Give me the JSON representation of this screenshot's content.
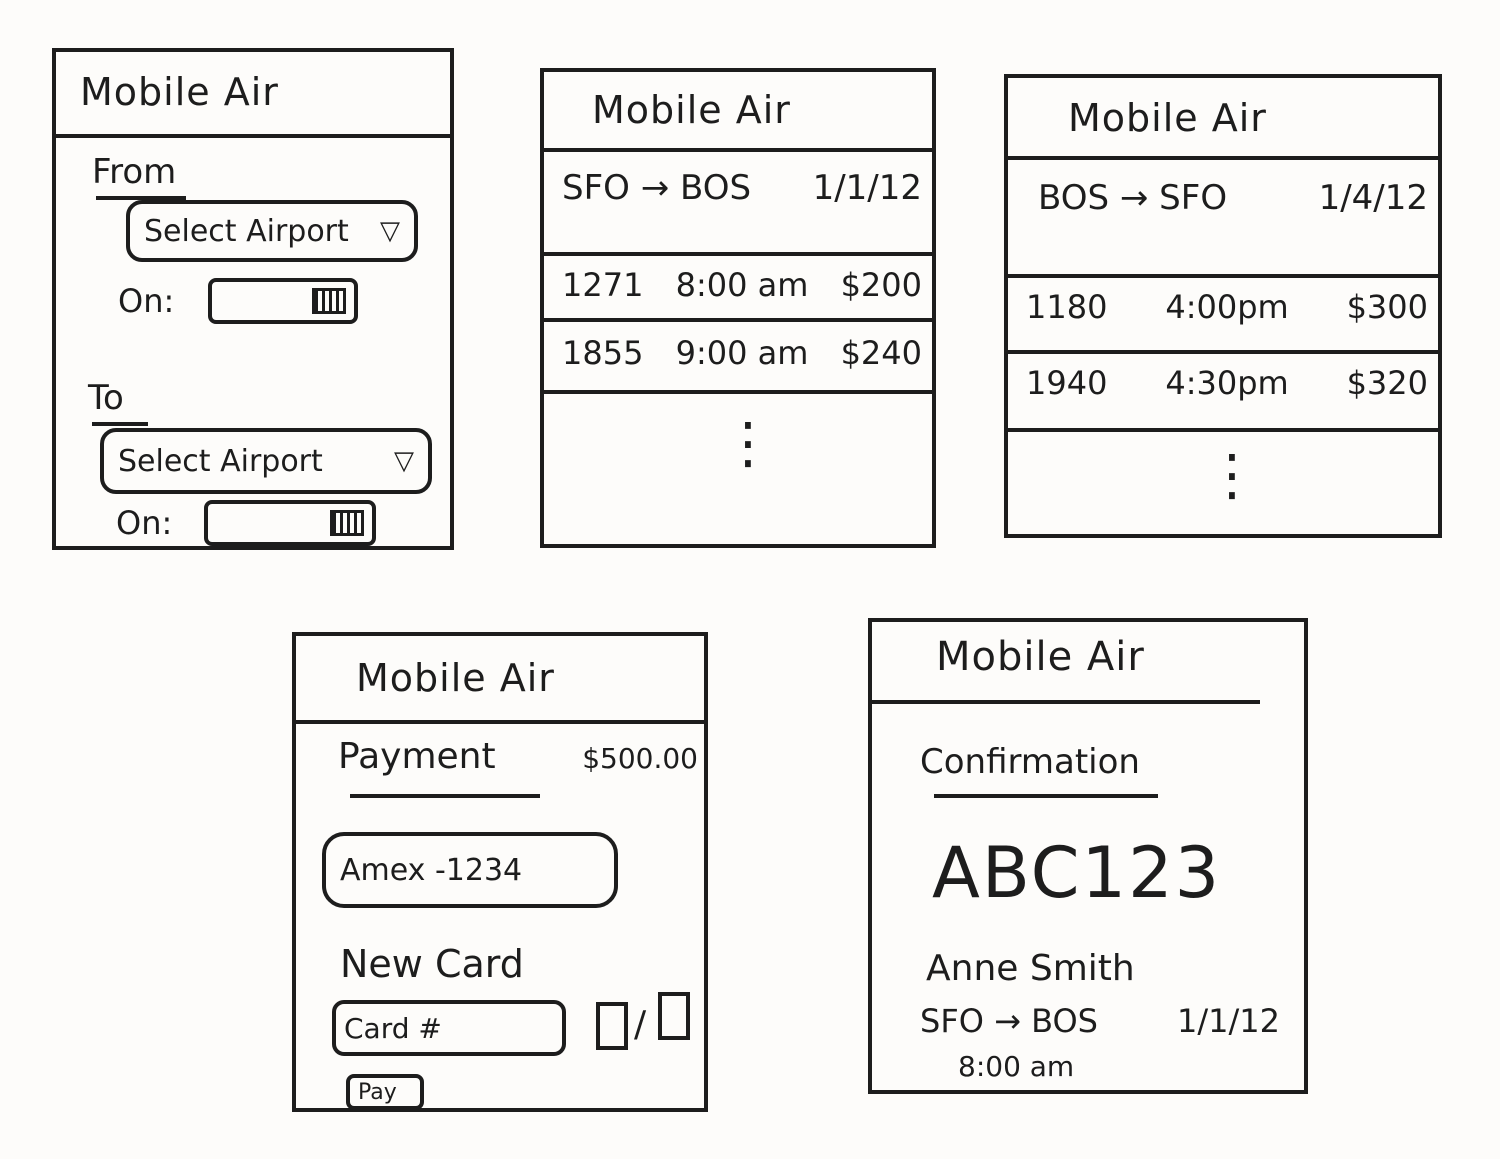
{
  "app_title": "Mobile Air",
  "search": {
    "from_label": "From",
    "from_select": "Select Airport",
    "from_on_label": "On:",
    "to_label": "To",
    "to_select": "Select Airport",
    "to_on_label": "On:",
    "caret": "▽"
  },
  "outbound": {
    "route": "SFO → BOS",
    "date": "1/1/12",
    "flights": [
      {
        "number": "1271",
        "time": "8:00 am",
        "price": "$200"
      },
      {
        "number": "1855",
        "time": "9:00 am",
        "price": "$240"
      }
    ],
    "more": "⋮"
  },
  "return": {
    "route": "BOS → SFO",
    "date": "1/4/12",
    "flights": [
      {
        "number": "1180",
        "time": "4:00pm",
        "price": "$300"
      },
      {
        "number": "1940",
        "time": "4:30pm",
        "price": "$320"
      }
    ],
    "more": "⋮"
  },
  "payment": {
    "title": "Payment",
    "total": "$500.00",
    "saved_card": "Amex -1234",
    "new_card_label": "New Card",
    "card_placeholder": "Card #",
    "expiry_separator": "/",
    "pay_label": "Pay"
  },
  "confirmation": {
    "title": "Confirmation",
    "code": "ABC123",
    "passenger": "Anne Smith",
    "route": "SFO → BOS",
    "date": "1/1/12",
    "time": "8:00 am"
  },
  "icons": {
    "calendar": "calendar-icon",
    "dropdown": "chevron-down-icon"
  }
}
